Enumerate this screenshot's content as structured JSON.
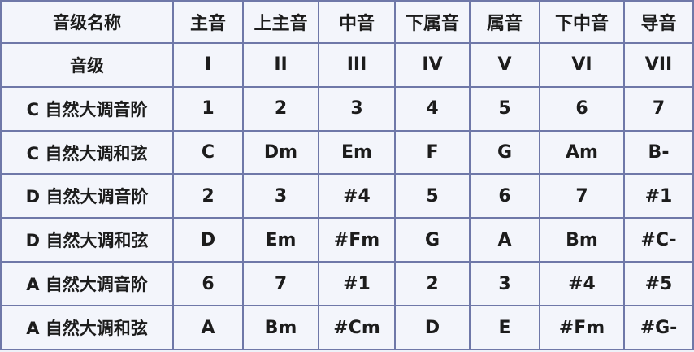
{
  "header": {
    "label": "音级名称",
    "degrees": [
      "主音",
      "上主音",
      "中音",
      "下属音",
      "属音",
      "下中音",
      "导音"
    ]
  },
  "rows": [
    {
      "label": "音级",
      "cells": [
        "I",
        "II",
        "III",
        "IV",
        "V",
        "VI",
        "VII"
      ]
    },
    {
      "label": "C 自然大调音阶",
      "cells": [
        "1",
        "2",
        "3",
        "4",
        "5",
        "6",
        "7"
      ]
    },
    {
      "label": "C 自然大调和弦",
      "cells": [
        "C",
        "Dm",
        "Em",
        "F",
        "G",
        "Am",
        "B-"
      ]
    },
    {
      "label": "D 自然大调音阶",
      "cells": [
        "2",
        "3",
        "#4",
        "5",
        "6",
        "7",
        "#1"
      ]
    },
    {
      "label": "D 自然大调和弦",
      "cells": [
        "D",
        "Em",
        "#Fm",
        "G",
        "A",
        "Bm",
        "#C-"
      ]
    },
    {
      "label": "A 自然大调音阶",
      "cells": [
        "6",
        "7",
        "#1",
        "2",
        "3",
        "#4",
        "#5"
      ]
    },
    {
      "label": "A 自然大调和弦",
      "cells": [
        "A",
        "Bm",
        "#Cm",
        "D",
        "E",
        "#Fm",
        "#G-"
      ]
    }
  ]
}
